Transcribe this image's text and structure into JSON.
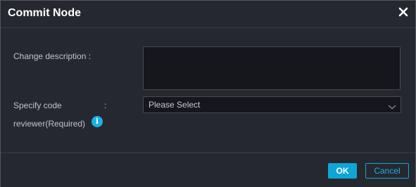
{
  "dialog": {
    "title": "Commit Node"
  },
  "form": {
    "change_description_label": "Change description :",
    "change_description_value": "",
    "specify_reviewer_label_line1": "Specify code",
    "specify_reviewer_colon": ":",
    "specify_reviewer_label_line2": "reviewer(Required)",
    "reviewer_select_value": "Please Select",
    "info_icon_glyph": "i"
  },
  "footer": {
    "ok_label": "OK",
    "cancel_label": "Cancel"
  },
  "colors": {
    "accent": "#0fa6d6",
    "background": "#262830",
    "input_background": "#16171c"
  },
  "icons": [
    "close-icon",
    "chevron-down-icon",
    "info-icon"
  ]
}
